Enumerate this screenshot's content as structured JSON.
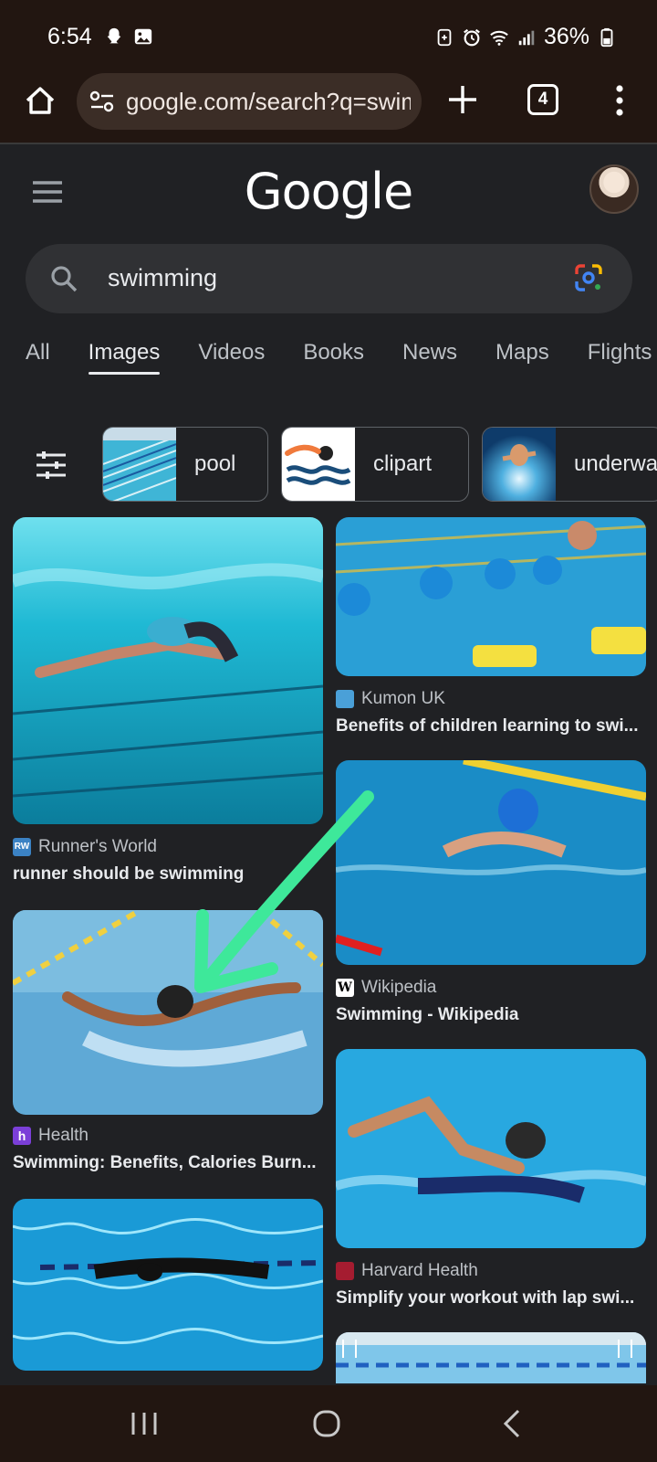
{
  "status": {
    "time": "6:54",
    "battery": "36%",
    "icons": [
      "snapchat-icon",
      "gallery-icon",
      "battery-saver-icon",
      "alarm-icon",
      "wifi-icon",
      "signal-icon",
      "battery-icon"
    ]
  },
  "browser": {
    "url": "google.com/search?q=swimming",
    "tab_count": "4"
  },
  "google": {
    "logo": "Google",
    "query": "swimming",
    "tabs": [
      "All",
      "Images",
      "Videos",
      "Books",
      "News",
      "Maps",
      "Flights"
    ],
    "active_tab": "Images"
  },
  "chips": [
    {
      "label": "pool"
    },
    {
      "label": "clipart"
    },
    {
      "label": "underwater"
    }
  ],
  "results": [
    {
      "source": "Runner's World",
      "favicon": "RW",
      "title": "runner should be swimming"
    },
    {
      "source": "Kumon UK",
      "favicon": "",
      "title": "Benefits of children learning to swi..."
    },
    {
      "source": "Wikipedia",
      "favicon": "W",
      "title": "Swimming - Wikipedia"
    },
    {
      "source": "Health",
      "favicon": "h",
      "title": "Swimming: Benefits, Calories Burn..."
    },
    {
      "source": "Harvard Health",
      "favicon": "",
      "title": "Simplify your workout with lap swi..."
    }
  ],
  "colors": {
    "annotation_arrow": "#3ee89a",
    "background": "#202124",
    "chrome_bar": "#221611"
  }
}
